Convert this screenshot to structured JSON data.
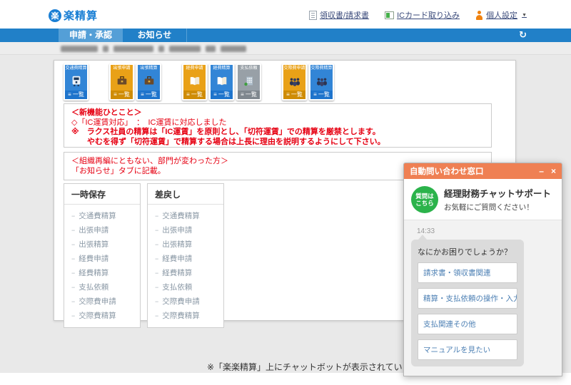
{
  "header": {
    "logo_badge": "楽",
    "logo_text": "楽精算",
    "links": [
      {
        "label": "領収書/請求書"
      },
      {
        "label": "ICカード取り込み"
      },
      {
        "label": "個人設定"
      }
    ]
  },
  "nav": {
    "tabs": [
      {
        "label": "申請・承認",
        "active": true
      },
      {
        "label": "お知らせ",
        "active": false
      }
    ]
  },
  "icons": {
    "refresh": "↻",
    "menu": "≡",
    "chevron_down": "▼",
    "minimize": "–",
    "close": "×"
  },
  "tiles": {
    "list_label": "一覧",
    "groups": [
      [
        {
          "title": "交通費精算",
          "color": "blue",
          "icon": "train-icon"
        }
      ],
      [
        {
          "title": "出張申請",
          "color": "orange",
          "icon": "briefcase-icon"
        },
        {
          "title": "出張精算",
          "color": "blue",
          "icon": "briefcase-icon"
        }
      ],
      [
        {
          "title": "経費申請",
          "color": "orange",
          "icon": "book-icon"
        },
        {
          "title": "経費精算",
          "color": "blue",
          "icon": "book-icon"
        },
        {
          "title": "支払依頼",
          "color": "gray",
          "icon": "building-icon"
        }
      ],
      [
        {
          "title": "交際費申請",
          "color": "orange",
          "icon": "people-icon"
        },
        {
          "title": "交際費精算",
          "color": "blue",
          "icon": "people-icon"
        }
      ]
    ]
  },
  "notices": [
    {
      "lines": [
        "＜新機能ひとこと＞",
        "◇「IC運賃対応」　：　IC運賃に対応しました",
        "※　ラクス社員の精算は「IC運賃」を原則とし、「切符運賃」での精算を厳禁とします。",
        "　　やむを得ず「切符運賃」で精算する場合は上長に理由を説明するようにして下さい。"
      ]
    },
    {
      "lines": [
        "＜組織再編にともない、部門が変わった方＞",
        "「お知らせ」タブに記載。"
      ]
    }
  ],
  "panels": [
    {
      "title": "一時保存",
      "items": [
        "交通費精算",
        "出張申請",
        "出張精算",
        "経費申請",
        "経費精算",
        "支払依頼",
        "交際費申請",
        "交際費精算"
      ]
    },
    {
      "title": "差戻し",
      "items": [
        "交通費精算",
        "出張申請",
        "出張精算",
        "経費申請",
        "経費精算",
        "支払依頼",
        "交際費申請",
        "交際費精算"
      ]
    }
  ],
  "caption": "※「楽楽精算」上にチャットボットが表示されているイメージ",
  "chatbot": {
    "window_title": "自動問い合わせ窓口",
    "badge_line1": "質問は",
    "badge_line2": "こちら",
    "support_title": "経理財務チャットサポート",
    "support_subtitle": "お気軽にご質問ください！",
    "timestamp": "14:33",
    "bubble_text": "なにかお困りでしょうか？",
    "options": [
      "請求書・領収書関連",
      "精算・支払依頼の操作・入力",
      "支払関連その他",
      "マニュアルを見たい"
    ]
  },
  "colors": {
    "nav_blue": "#2180c8",
    "tab_active_blue": "#549fd7",
    "logo_blue": "#1a7fd4",
    "notice_red": "#e60012",
    "tile_blue": "#3285d6",
    "tile_orange": "#e9a117",
    "tile_gray": "#98a0a7",
    "chat_header_orange": "#ef8053",
    "badge_green": "#2bb34b",
    "option_link_blue": "#4d80b4"
  }
}
